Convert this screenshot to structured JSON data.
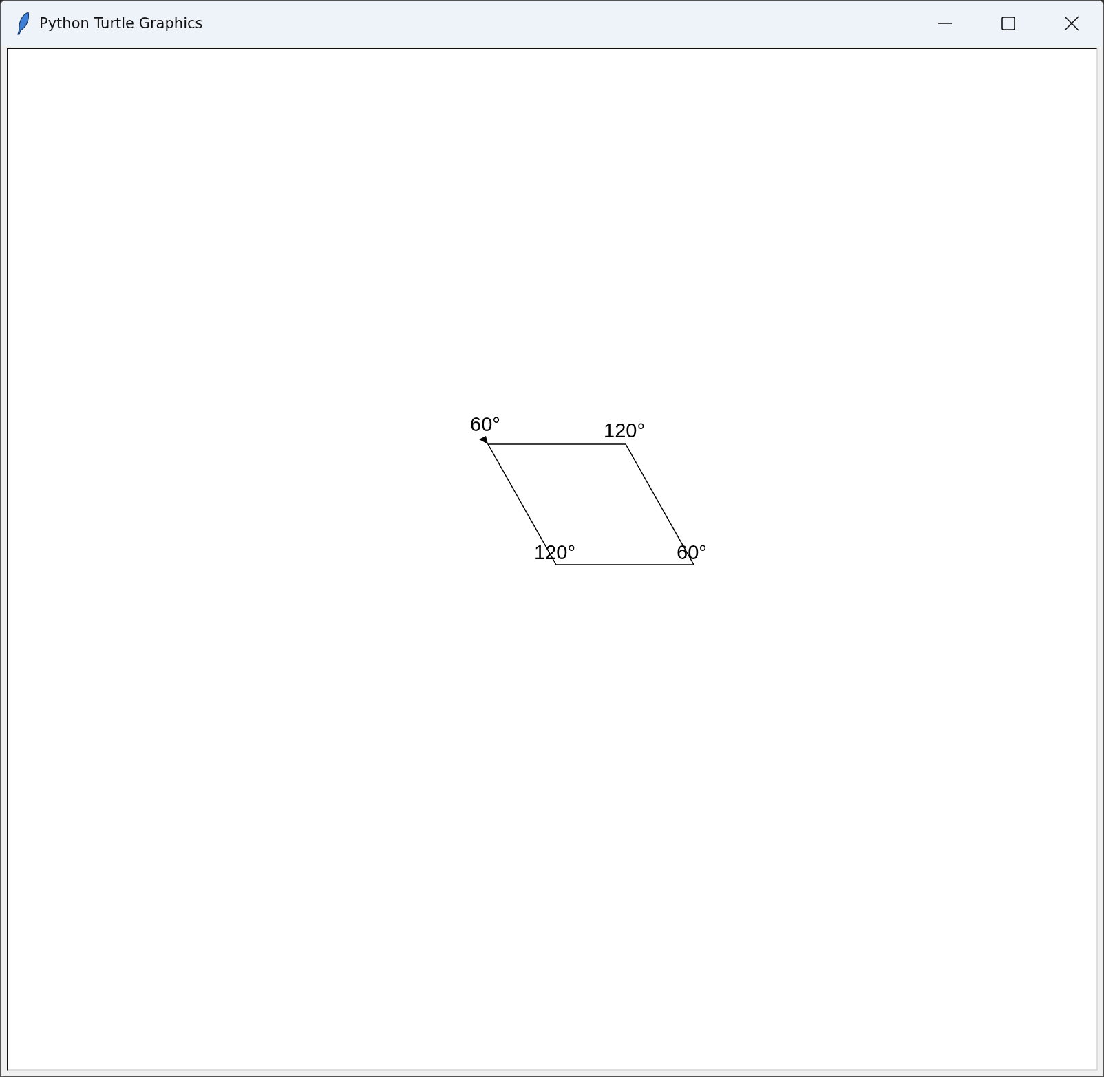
{
  "window": {
    "title": "Python Turtle Graphics"
  },
  "canvas": {
    "angle_labels": [
      "60°",
      "120°",
      "120°",
      "60°"
    ]
  }
}
